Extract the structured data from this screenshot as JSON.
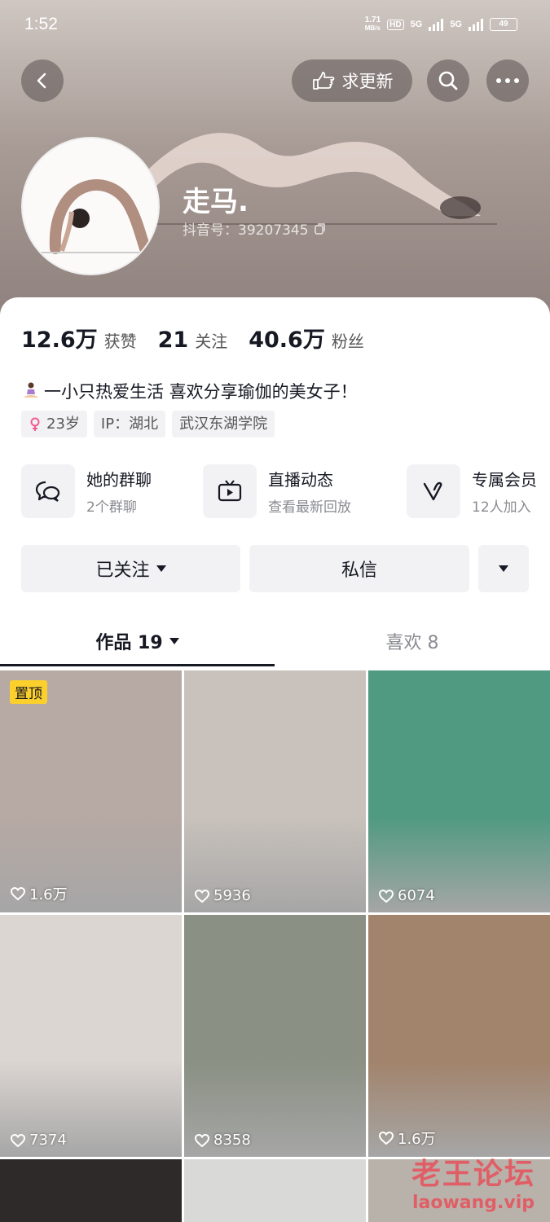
{
  "status_bar": {
    "time": "1:52",
    "net_speed_value": "1.71",
    "net_speed_unit": "MB/s",
    "hd_label": "HD",
    "network_1": "5G",
    "network_2": "5G",
    "battery": "49"
  },
  "header": {
    "update_button_label": "求更新",
    "nickname": "走马.",
    "douyin_id": "抖音号：39207345"
  },
  "stats": [
    {
      "num": "12.6万",
      "label": "获赞"
    },
    {
      "num": "21",
      "label": "关注"
    },
    {
      "num": "40.6万",
      "label": "粉丝"
    }
  ],
  "bio": "一小只热爱生活 喜欢分享瑜伽的美女子！",
  "tags": {
    "age": "23岁",
    "ip": "IP：湖北",
    "school": "武汉东湖学院"
  },
  "features": [
    {
      "title": "她的群聊",
      "subtitle": "2个群聊",
      "icon": "chat-bubbles-icon"
    },
    {
      "title": "直播动态",
      "subtitle": "查看最新回放",
      "icon": "tv-play-icon"
    },
    {
      "title": "专属会员",
      "subtitle": "12人加入",
      "icon": "v-member-icon"
    }
  ],
  "actions": {
    "follow_label": "已关注",
    "message_label": "私信"
  },
  "tabs": {
    "works_label": "作品 19",
    "likes_label": "喜欢 8"
  },
  "videos": [
    {
      "likes": "1.6万",
      "pinned_label": "置顶",
      "bg": "#b7a9a4"
    },
    {
      "likes": "5936",
      "bg": "#c9c2bc"
    },
    {
      "likes": "6074",
      "bg": "#4f9a80"
    },
    {
      "likes": "7374",
      "bg": "#dcd6d2"
    },
    {
      "likes": "8358",
      "bg": "#8a9083"
    },
    {
      "likes": "1.6万",
      "bg": "#a2836b"
    }
  ],
  "watermark": {
    "line1": "老王论坛",
    "line2": "laowang.vip"
  },
  "colors": {
    "pin_badge": "#fcd02c",
    "tab_underline": "#161823",
    "watermark": "#e6505a"
  }
}
